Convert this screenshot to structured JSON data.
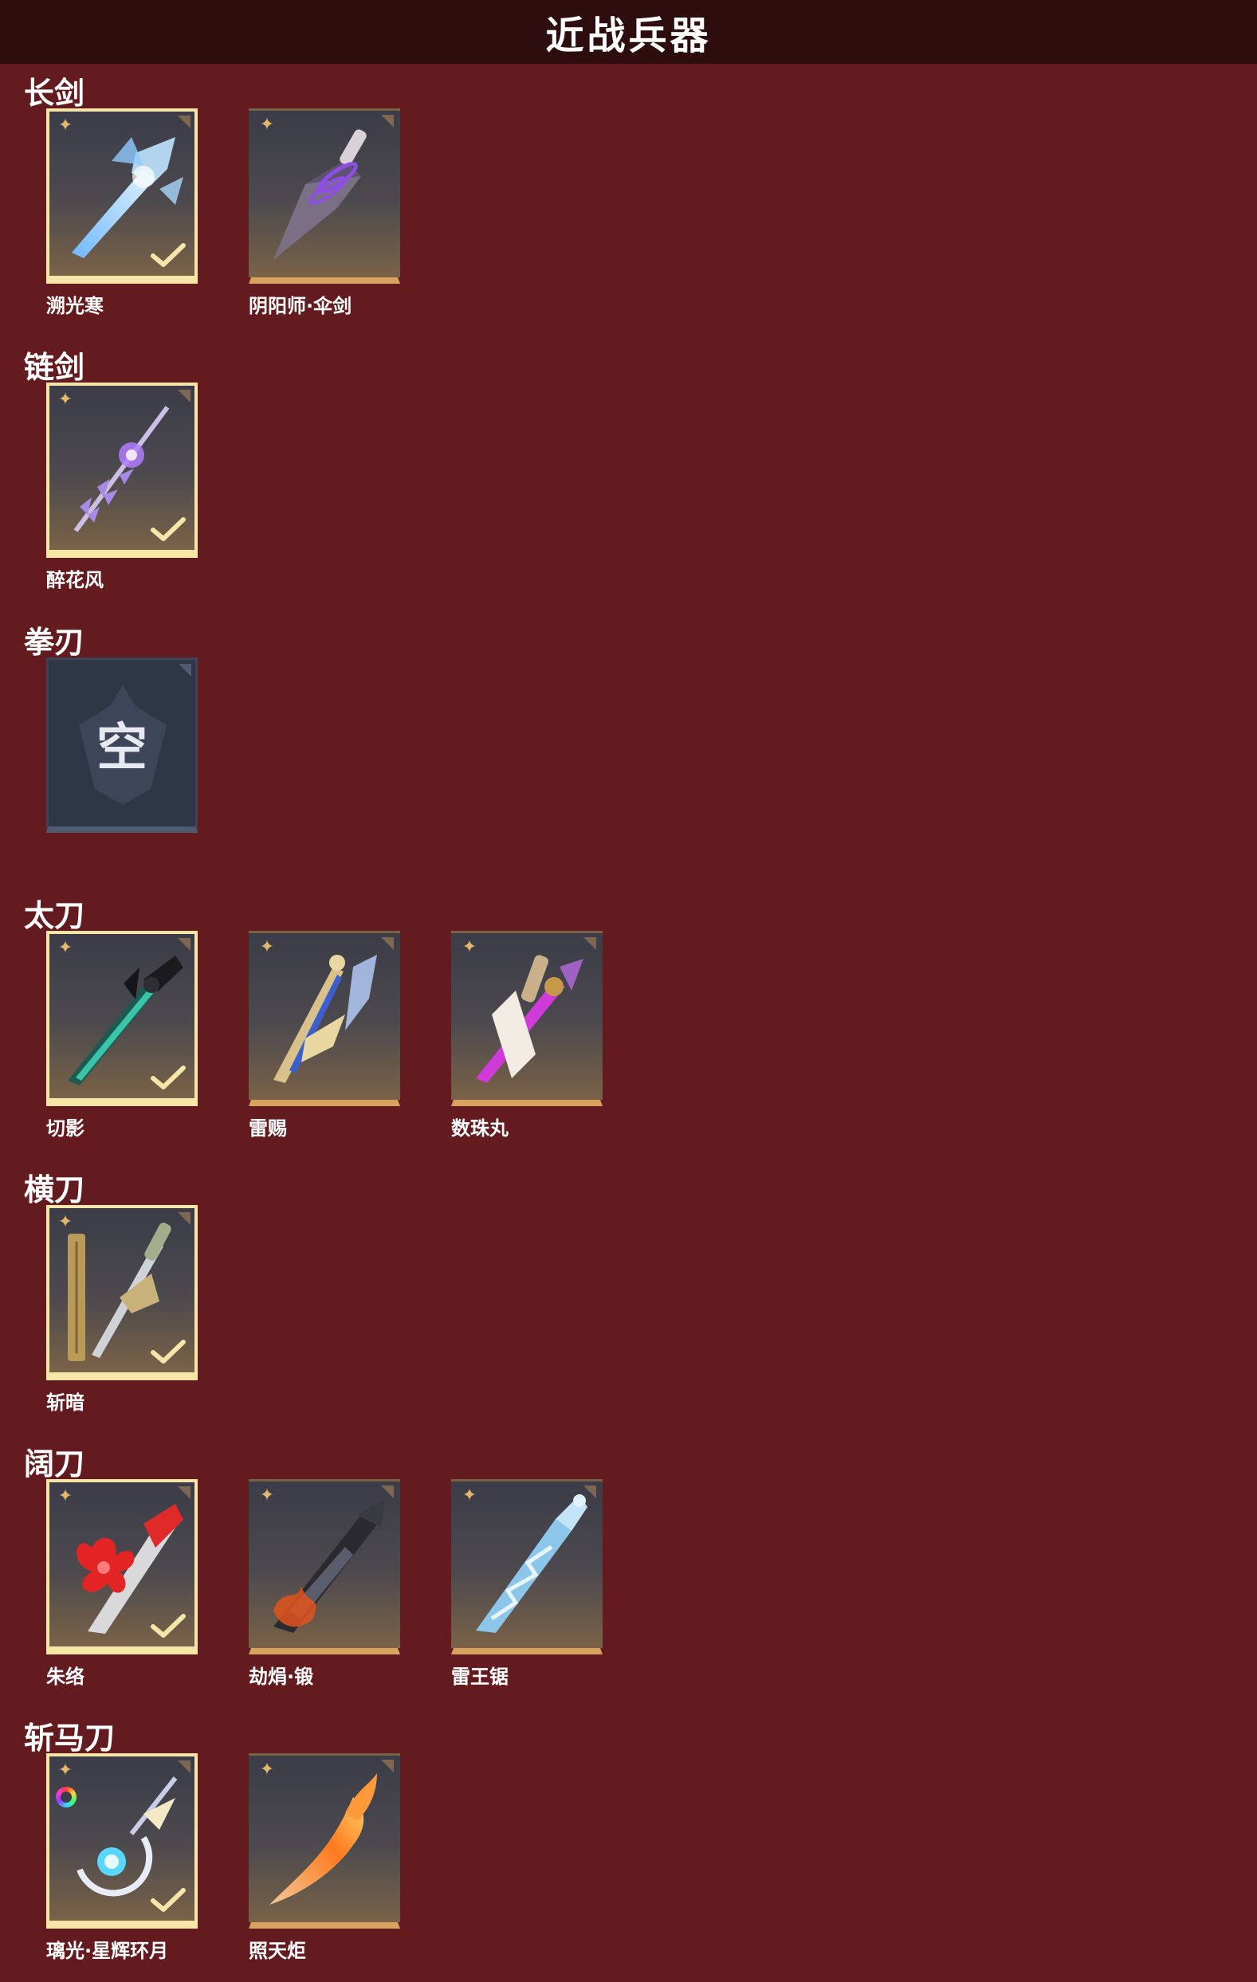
{
  "header": {
    "title": "近战兵器"
  },
  "empty_glyph": "空",
  "categories": [
    {
      "name": "长剑",
      "items": [
        {
          "name": "溯光寒",
          "icon": "ice-longsword-icon",
          "selected": true
        },
        {
          "name": "阴阳师·伞剑",
          "icon": "umbrella-sword-icon",
          "selected": false
        }
      ]
    },
    {
      "name": "链剑",
      "items": [
        {
          "name": "醉花风",
          "icon": "crystal-chain-sword-icon",
          "selected": true
        }
      ]
    },
    {
      "name": "拳刃",
      "items": [
        {
          "name": "",
          "icon": "empty-slot-icon",
          "empty": true
        }
      ]
    },
    {
      "name": "太刀",
      "items": [
        {
          "name": "切影",
          "icon": "jade-tachi-icon",
          "selected": true
        },
        {
          "name": "雷赐",
          "icon": "thunder-tachi-icon",
          "selected": false
        },
        {
          "name": "数珠丸",
          "icon": "violet-tachi-icon",
          "selected": false
        }
      ]
    },
    {
      "name": "横刀",
      "items": [
        {
          "name": "斩暗",
          "icon": "golden-hengdao-icon",
          "selected": true
        }
      ]
    },
    {
      "name": "阔刀",
      "items": [
        {
          "name": "朱络",
          "icon": "crimson-butterfly-blade-icon",
          "selected": true
        },
        {
          "name": "劫焆·锻",
          "icon": "ember-greatblade-icon",
          "selected": false
        },
        {
          "name": "雷王锯",
          "icon": "lightning-saw-blade-icon",
          "selected": false
        }
      ]
    },
    {
      "name": "斩马刀",
      "items": [
        {
          "name": "璃光·星辉环月",
          "icon": "moon-ring-zhanmadao-icon",
          "selected": true,
          "rainbow": true
        },
        {
          "name": "照天炬",
          "icon": "flame-zhanmadao-icon",
          "selected": false
        }
      ]
    }
  ],
  "colors": {
    "background": "#641b1f",
    "header": "#2d0d0e",
    "selected_border": "#f7e6a8",
    "tile_bottom": "#d8a262",
    "star": "#e2b86b"
  }
}
